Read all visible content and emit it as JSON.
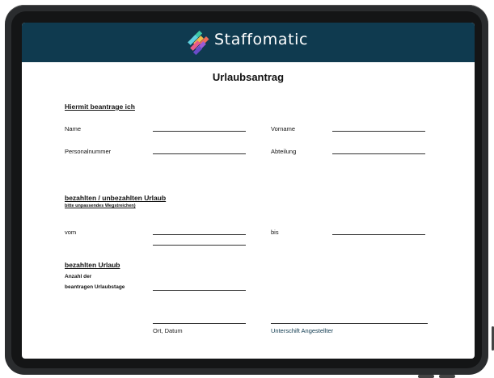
{
  "brand": {
    "name": "Staffomatic",
    "logo_icon": "staffomatic-logo-icon",
    "header_color": "#0f3a4f"
  },
  "form": {
    "title": "Urlaubsantrag",
    "section1": {
      "heading": "Hiermit beantrage ich",
      "fields": {
        "name": "Name",
        "vorname": "Vorname",
        "personalnummer": "Personalnummer",
        "abteilung": "Abteilung"
      }
    },
    "section2": {
      "heading": "bezahlten / unbezahlten Urlaub",
      "note": "bitte unpassendes Wegstreichen)",
      "from": "vom",
      "to": "bis"
    },
    "section3": {
      "heading": "bezahlten Urlaub",
      "count_label_1": "Anzahl der",
      "count_label_2": "beantragen Urlaubstage"
    },
    "signatures": {
      "place_date": "Ort, Datum",
      "employee": "Unterschift Angestellter"
    }
  }
}
